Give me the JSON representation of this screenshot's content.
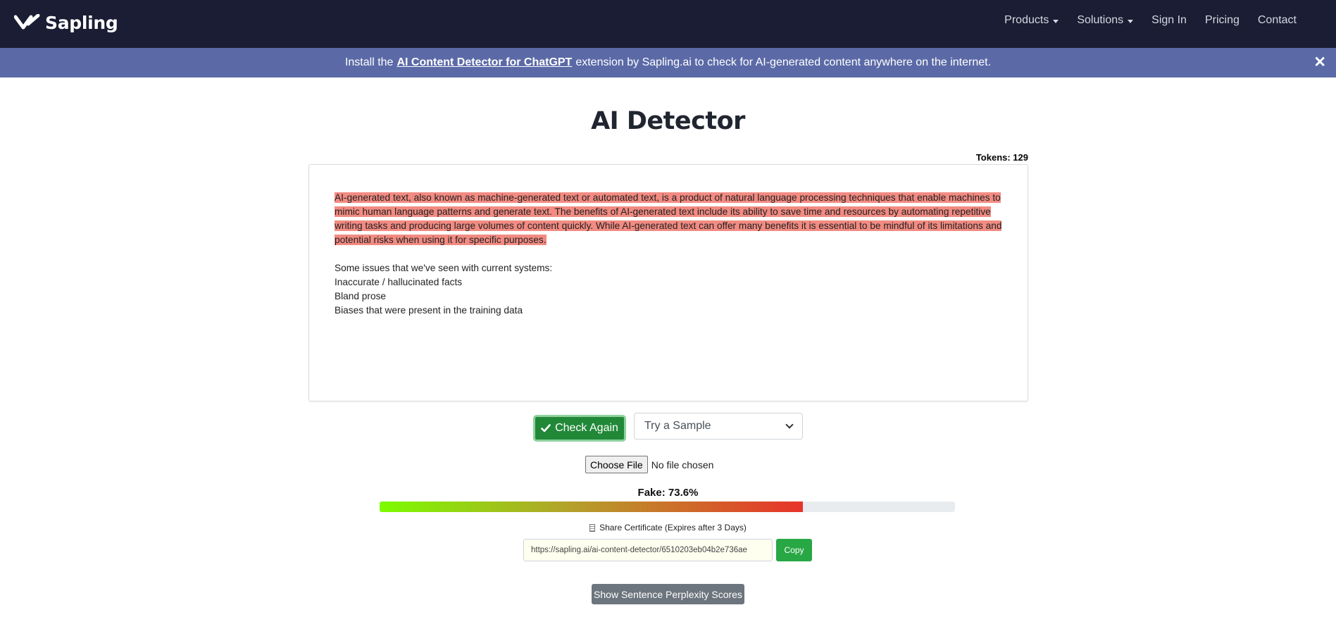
{
  "nav": {
    "brand": "Sapling",
    "links": [
      "Products",
      "Solutions",
      "Sign In",
      "Pricing",
      "Contact"
    ]
  },
  "banner": {
    "prefix": "Install the",
    "link": "AI Content Detector for ChatGPT",
    "suffix": "extension by Sapling.ai to check for AI-generated content anywhere on the internet.",
    "close": "✕"
  },
  "main": {
    "title": "AI Detector",
    "tokens": "Tokens: 129"
  },
  "editor": {
    "highlighted": "AI-generated text, also known as machine-generated text or automated text, is a product of natural language processing techniques that enable machines to mimic human language patterns and generate text. The benefits of AI-generated text include its ability to save time and resources by automating repetitive writing tasks and producing large volumes of content quickly. While AI-generated text can offer many benefits it is essential to be mindful of its limitations and potential risks when using it for specific purposes.",
    "lines": [
      "Some issues that we've seen with current systems:",
      "Inaccurate / hallucinated facts",
      "Bland prose",
      "Biases that were present in the training data"
    ]
  },
  "controls": {
    "check_label": "Check Again",
    "sample_select": "Try a Sample",
    "file_button": "Choose File",
    "file_status": "No file chosen"
  },
  "result": {
    "fake_label": "Fake: 73.6%",
    "fake_fraction": 0.736,
    "share_label": "Share Certificate (Expires after 3 Days)",
    "share_url": "https://sapling.ai/ai-content-detector/6510203eb04b2e736ae",
    "copy_label": "Copy",
    "perplexity_label": "Show Sentence Perplexity Scores"
  },
  "colors": {
    "navbar": "#1a1d33",
    "banner": "#5b6aa7",
    "highlight": "#f28b82",
    "check_button": "#218838",
    "copy_button": "#28a745",
    "perplexity_button": "#6c757d"
  }
}
